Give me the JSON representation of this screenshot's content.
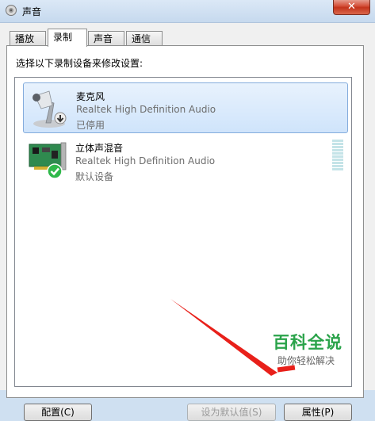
{
  "window": {
    "title": "声音",
    "close_glyph": "✕"
  },
  "tabs": [
    {
      "label": "播放"
    },
    {
      "label": "录制",
      "active": true
    },
    {
      "label": "声音"
    },
    {
      "label": "通信"
    }
  ],
  "panel": {
    "instruction": "选择以下录制设备来修改设置:"
  },
  "devices": [
    {
      "name": "麦克风",
      "description": "Realtek High Definition Audio",
      "status": "已停用",
      "icon": "microphone-icon",
      "status_icon": "disabled-arrow-icon",
      "selected": true
    },
    {
      "name": "立体声混音",
      "description": "Realtek High Definition Audio",
      "status": "默认设备",
      "icon": "sound-card-icon",
      "status_icon": "default-check-icon",
      "selected": false
    }
  ],
  "buttons": {
    "configure": "配置(C)",
    "set_default": "设为默认值(S)",
    "properties": "属性(P)"
  },
  "watermark": {
    "main": "百科全说",
    "sub": "助你轻松解决"
  },
  "colors": {
    "selection": "#cfe4fb",
    "watermark": "#2aa34a",
    "arrow": "#e8201a"
  }
}
